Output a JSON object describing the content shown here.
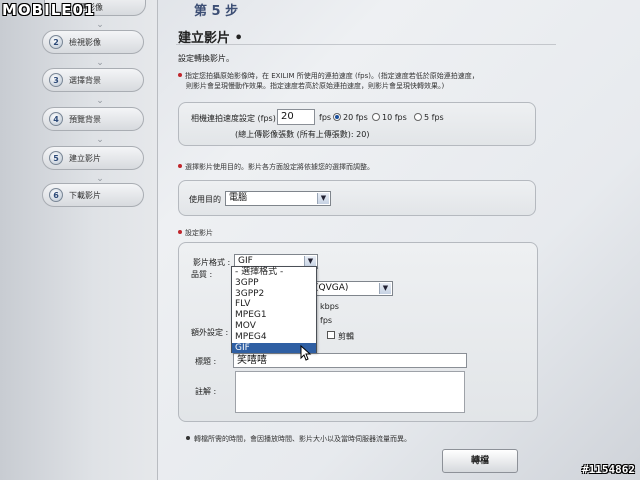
{
  "logo": {
    "text": "MOBILE01"
  },
  "sidebar": {
    "items": [
      {
        "num": "",
        "label": "上傳影像"
      },
      {
        "num": "2",
        "label": "檢視影像"
      },
      {
        "num": "3",
        "label": "選擇背景"
      },
      {
        "num": "4",
        "label": "預覽背景"
      },
      {
        "num": "5",
        "label": "建立影片"
      },
      {
        "num": "6",
        "label": "下載影片"
      }
    ]
  },
  "header": {
    "step_badge": "第 5 步",
    "title": "建立影片 •"
  },
  "section_convert": {
    "subtitle": "設定轉換影片。"
  },
  "note1": {
    "line1": "指定您拍攝原始影像時，在 EXILIM 所使用的連拍速度 (fps)。(指定速度若低於原始連拍速度，",
    "line2": "則影片會呈現慢動作效果。指定速度若高於原始連拍速度，則影片會呈現快轉效果。)"
  },
  "fps_panel": {
    "label": "相機連拍速度設定 (fps)",
    "value": "20",
    "unit": "fps",
    "options": [
      {
        "label": "20 fps",
        "selected": true
      },
      {
        "label": "10 fps",
        "selected": false
      },
      {
        "label": "5 fps",
        "selected": false
      }
    ],
    "total_frames": "(總上傳影像張數 (所有上傳張數): 20)"
  },
  "note2": {
    "text": "選擇影片使用目的。影片各方面設定將依據您的選擇而調整。"
  },
  "purpose_panel": {
    "label": "使用目的",
    "value": "電腦"
  },
  "settings_section": {
    "title": "設定影片"
  },
  "video_settings": {
    "format_label": "影片格式 :",
    "format_value": "GIF",
    "quality_label": "品質 :",
    "quality_value": "(QVGA)",
    "bitrate_1": "kbps",
    "bitrate_2": "fps",
    "extra_label": "額外設定 :",
    "extra_checkbox_label": "剪輯",
    "title_label": "標題 :",
    "title_value": "笑嘻嘻",
    "note_label": "註解 :"
  },
  "format_dropdown": {
    "options": [
      "- 選擇格式 -",
      "3GPP",
      "3GPP2",
      "FLV",
      "MPEG1",
      "MOV",
      "MPEG4",
      "GIF"
    ],
    "selected": "GIF"
  },
  "footer": {
    "note": "轉檔所需的時間，會因播放時間、影片大小以及當時伺服器流量而異。",
    "convert_button": "轉檔"
  },
  "watermark": {
    "text": "#1154862"
  },
  "colors": {
    "accent": "#3d4f75",
    "bullet": "#c0262c",
    "selection": "#2f5fa3"
  }
}
